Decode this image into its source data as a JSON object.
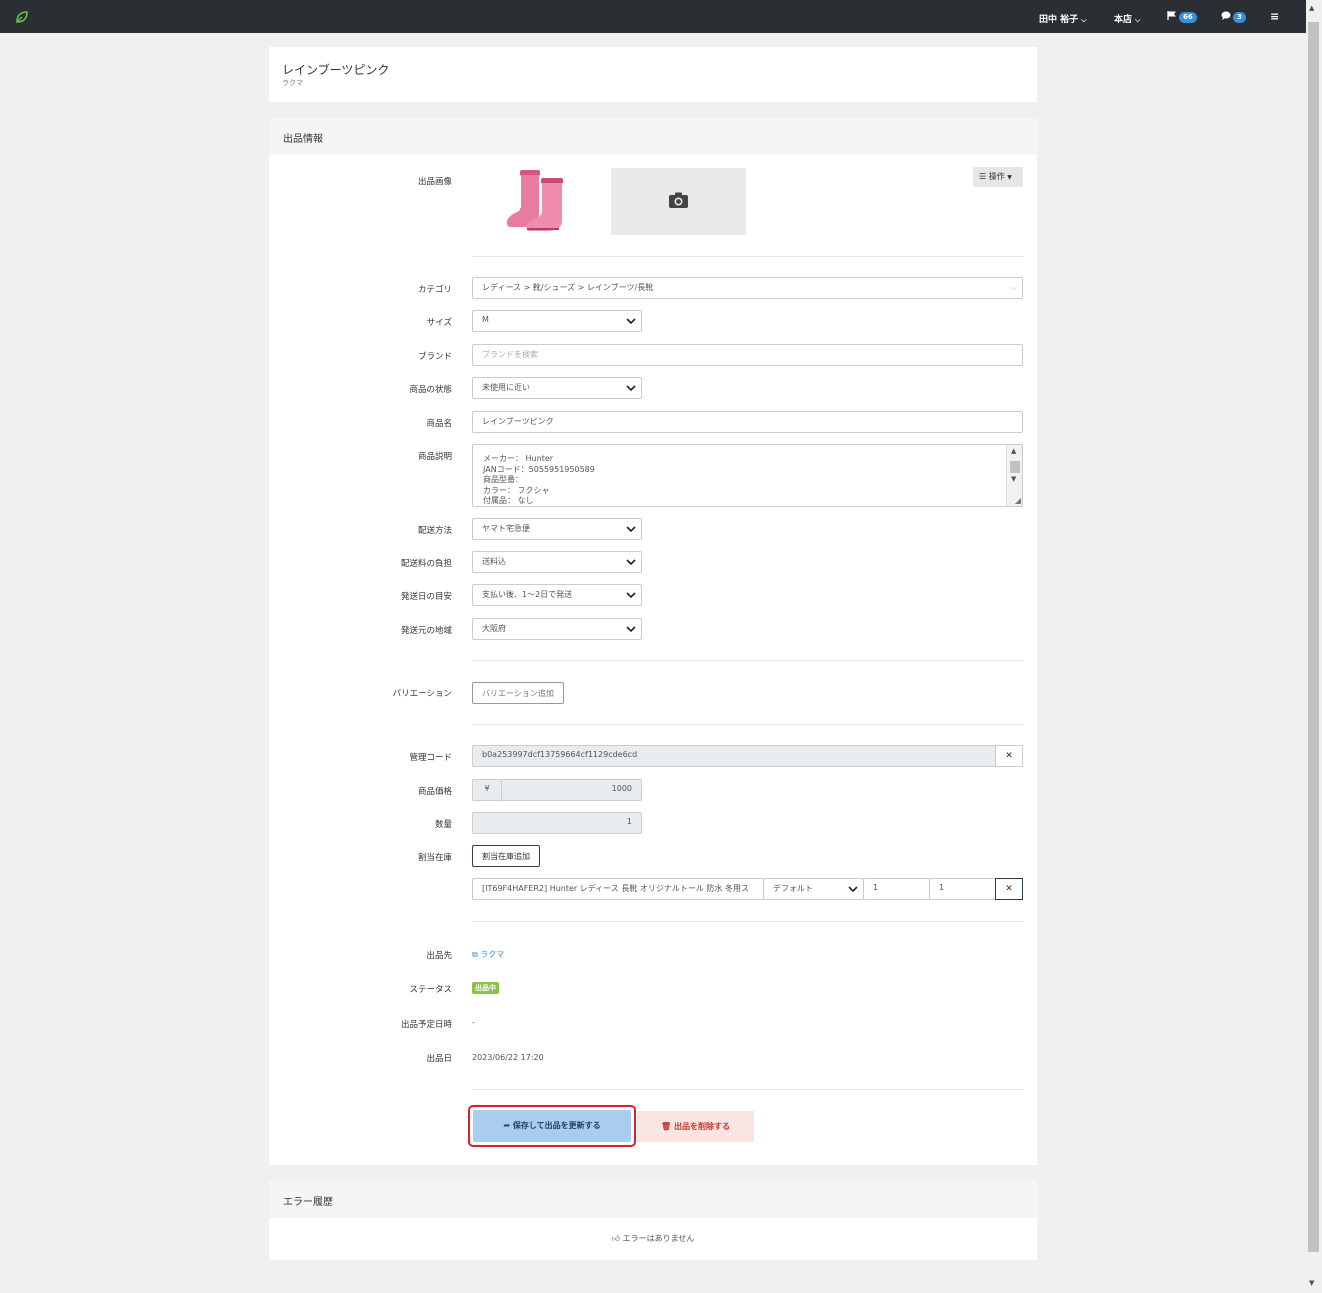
{
  "topbar": {
    "user": "田中 裕子",
    "store": "本店",
    "flag_count": "66",
    "message_count": "3"
  },
  "header": {
    "title": "レインブーツピンク",
    "subtitle": "ラクマ"
  },
  "section": {
    "title": "出品情報"
  },
  "labels": {
    "image": "出品画像",
    "category": "カテゴリ",
    "size": "サイズ",
    "brand": "ブランド",
    "condition": "商品の状態",
    "name": "商品名",
    "description": "商品説明",
    "shipping_method": "配送方法",
    "shipping_fee": "配送料の負担",
    "ship_days": "発送日の目安",
    "ship_from": "発送元の地域",
    "variation": "バリエーション",
    "code": "管理コード",
    "price": "商品価格",
    "quantity": "数量",
    "stock": "割当在庫",
    "destination": "出品先",
    "status": "ステータス",
    "scheduled": "出品予定日時",
    "listed": "出品日"
  },
  "form": {
    "operations_label": "操作",
    "category": "レディース > 靴/シューズ > レインブーツ/長靴",
    "size": "M",
    "brand_placeholder": "ブランドを検索",
    "condition": "未使用に近い",
    "name": "レインブーツピンク",
    "description_lines": [
      "メーカー： Hunter",
      "JANコード：5055951950589",
      "商品型番：",
      "カラー： フクシャ",
      "付属品： なし"
    ],
    "shipping_method": "ヤマト宅急便",
    "shipping_fee": "送料込",
    "ship_days": "支払い後、1〜2日で発送",
    "ship_from": "大阪府",
    "variation_button": "バリエーション追加",
    "code": "b0a253997dcf13759664cf1129cde6cd",
    "currency": "¥",
    "price": "1000",
    "quantity": "1",
    "stock_add_button": "割当在庫追加",
    "stock_item": "[IT69F4HAFER2] Hunter レディース 長靴 オリジナルトール 防水 冬用ス",
    "stock_warehouse": "デフォルト",
    "stock_qty1": "1",
    "stock_qty2": "1",
    "destination_link": "ラクマ",
    "status_badge": "出品中",
    "scheduled": "-",
    "listed": "2023/06/22 17:20",
    "save_button": "保存して出品を更新する",
    "delete_button": "出品を削除する"
  },
  "errors": {
    "title": "エラー履歴",
    "empty": "エラーはありません"
  },
  "colors": {
    "topbar": "#2b2f33",
    "badge": "#3b8ed8",
    "status": "#8bc34a",
    "save": "#a9cdee",
    "delete_bg": "#fbe4e4",
    "highlight": "#e02020"
  }
}
